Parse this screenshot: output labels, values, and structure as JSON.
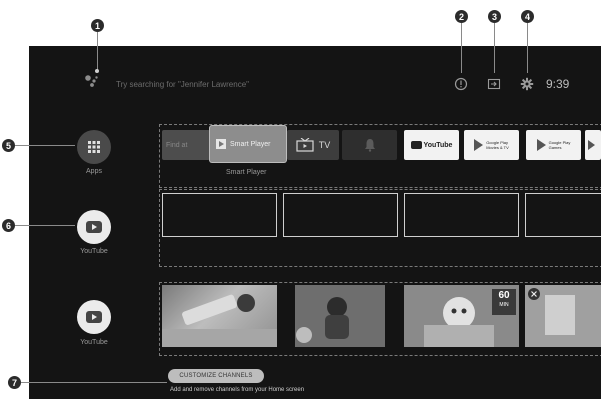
{
  "callouts": [
    "1",
    "2",
    "3",
    "4",
    "5",
    "6",
    "7"
  ],
  "top_bar": {
    "search_hint": "Try searching for \"Jennifer Lawrence\"",
    "clock": "9:39"
  },
  "left_column": {
    "apps_label": "Apps",
    "youtube_label_1": "YouTube",
    "youtube_label_2": "YouTube"
  },
  "apps_row": {
    "faded_label": "Find at",
    "smart_player_tile_label": "Smart Player",
    "tv_label": "TV",
    "focused_caption": "Smart Player",
    "youtube_tile_label": "YouTube",
    "google_play_movies_label": "Google Play\nMovies & TV",
    "google_play_games_label": "Google Play\nGames"
  },
  "video_row": {
    "badge_number": "60",
    "badge_unit": "MIN"
  },
  "customize": {
    "button_label": "CUSTOMIZE CHANNELS",
    "subtitle": "Add and remove channels from your Home screen"
  },
  "colors": {
    "screen_bg": "#141414",
    "accent_light": "#ebebeb"
  }
}
